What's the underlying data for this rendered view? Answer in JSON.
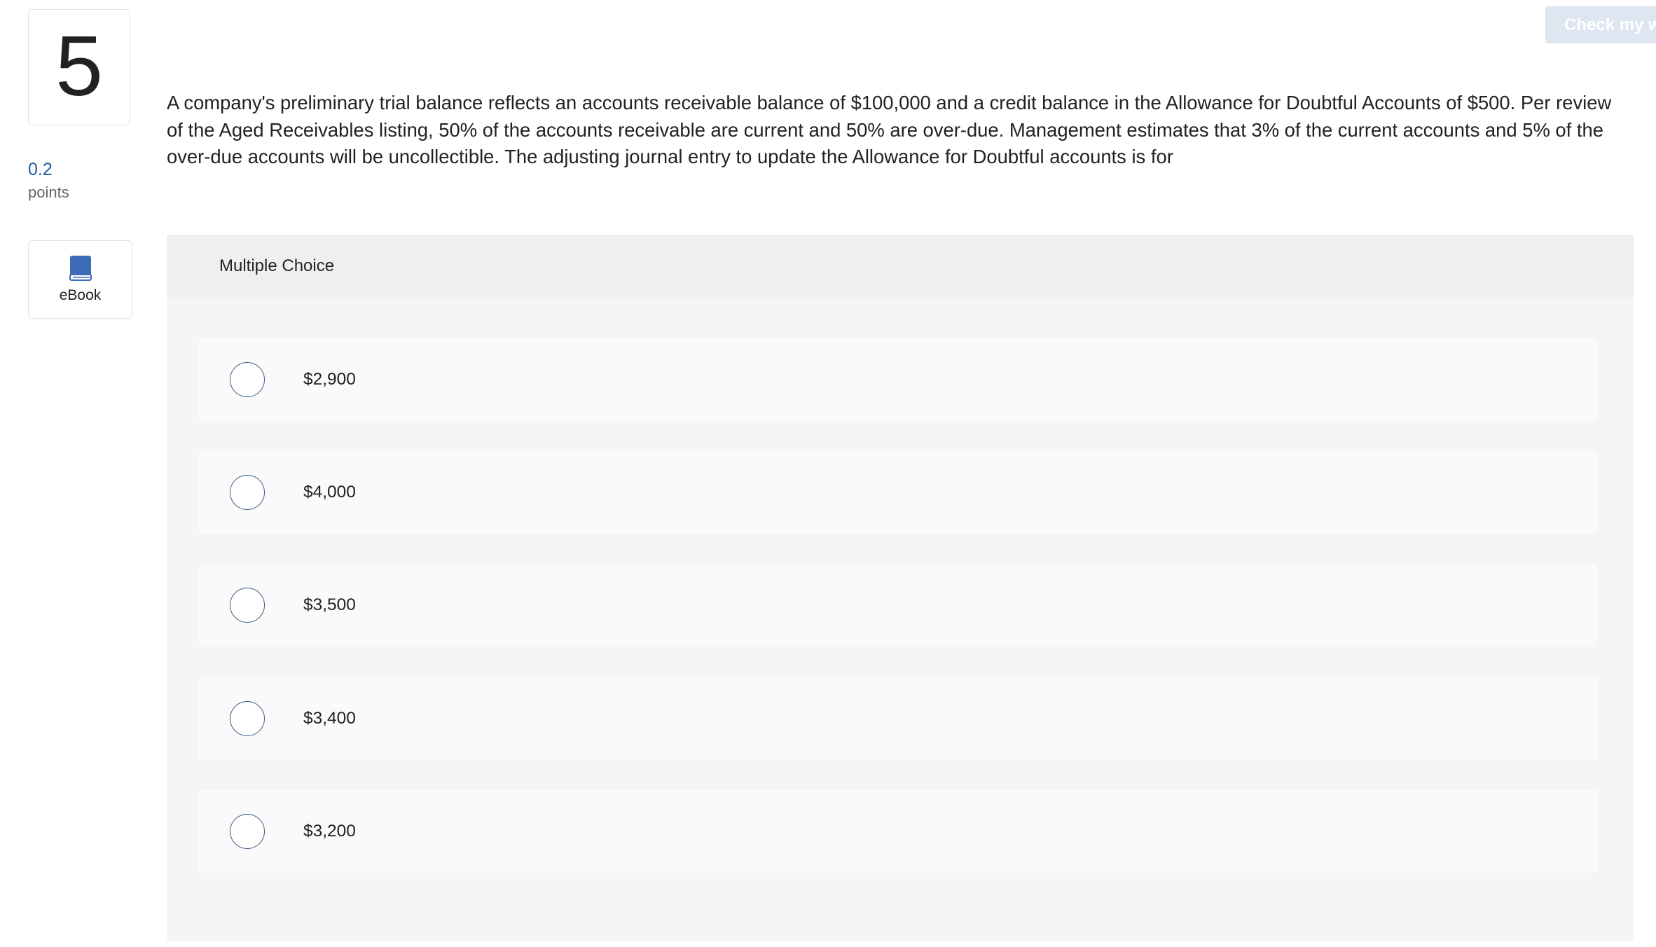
{
  "question": {
    "number": "5",
    "points_value": "0.2",
    "points_label": "points",
    "text": "A company's preliminary trial balance reflects an accounts receivable balance of $100,000 and a credit balance in the Allowance for Doubtful Accounts of $500. Per review of the Aged Receivables listing, 50% of the accounts receivable are current and 50% are over-due. Management estimates that 3% of the current accounts and 5% of the over-due accounts will be uncollectible. The adjusting journal entry to update the Allowance for Doubtful accounts is for"
  },
  "ebook": {
    "label": "eBook",
    "icon": "book-icon"
  },
  "toolbar": {
    "check_label": "Check my work"
  },
  "multiple_choice": {
    "header": "Multiple Choice",
    "options": [
      {
        "label": "$2,900"
      },
      {
        "label": "$4,000"
      },
      {
        "label": "$3,500"
      },
      {
        "label": "$3,400"
      },
      {
        "label": "$3,200"
      }
    ]
  },
  "colors": {
    "accent": "#1f5ea0",
    "radio_border": "#3a5a84",
    "book_icon": "#3d6bb5",
    "check_button_bg": "#dde6f1"
  }
}
